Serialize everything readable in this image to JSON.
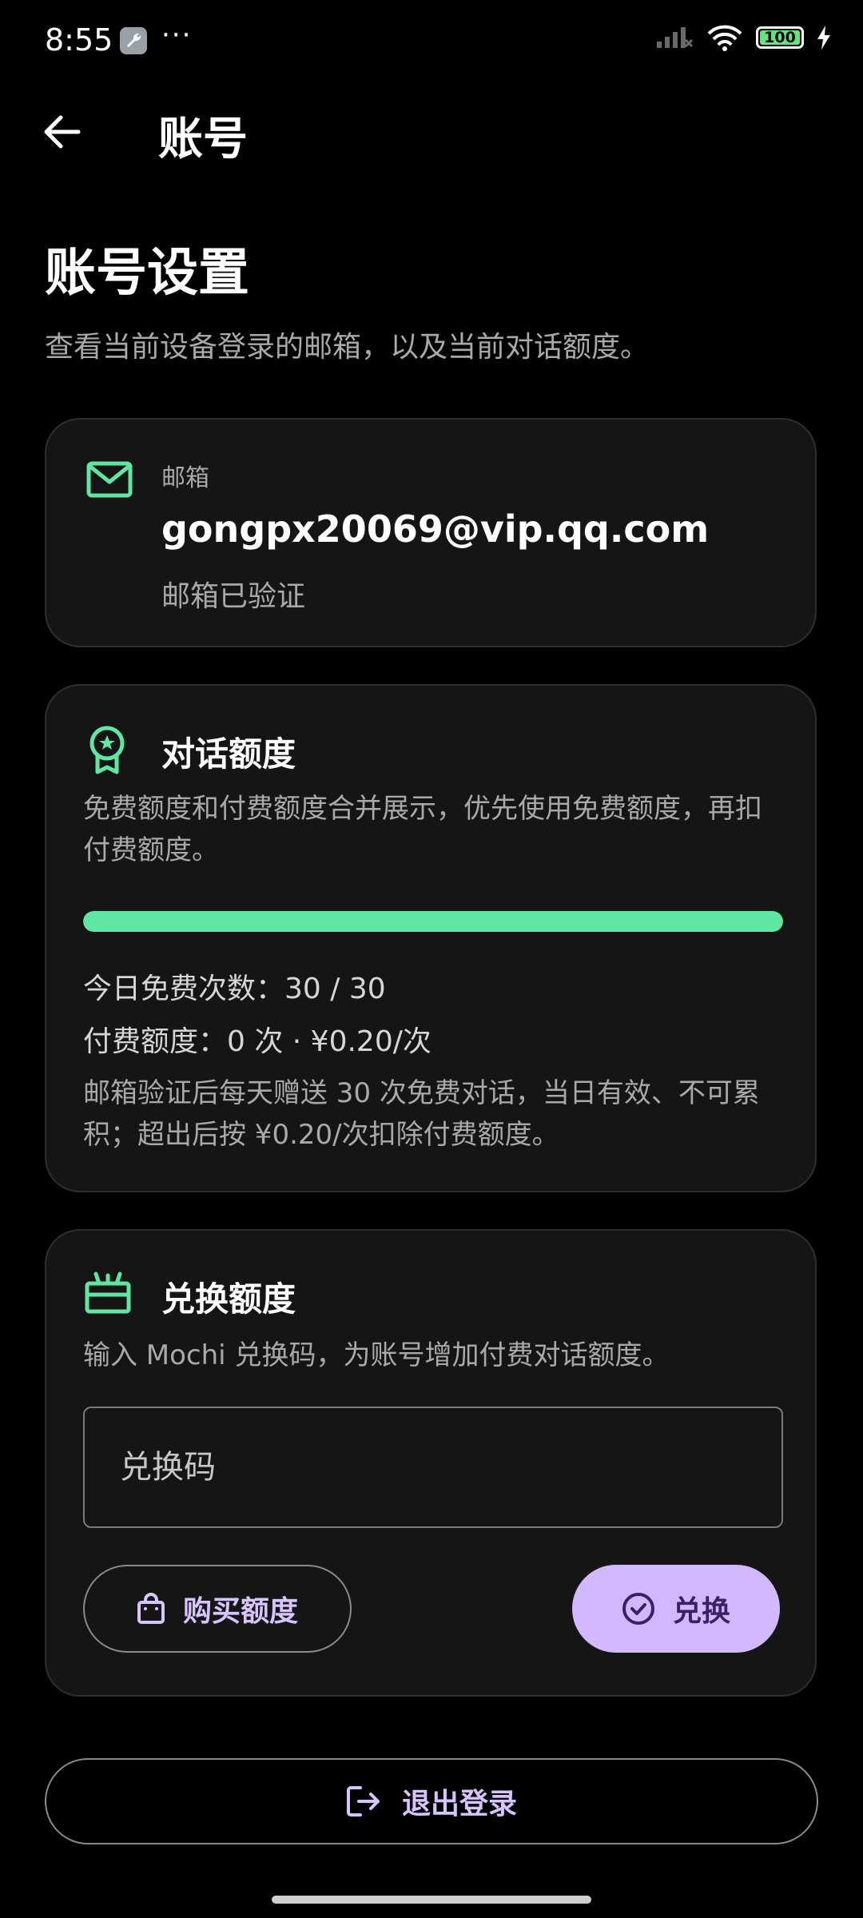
{
  "status_bar": {
    "time": "8:55",
    "dots": "···",
    "battery_level": 100,
    "battery_text": "100"
  },
  "app_bar": {
    "title": "账号"
  },
  "page": {
    "heading": "账号设置",
    "subtitle": "查看当前设备登录的邮箱，以及当前对话额度。"
  },
  "email_card": {
    "label": "邮箱",
    "email": "gongpx20069@vip.qq.com",
    "status": "邮箱已验证",
    "icon": "mail-icon"
  },
  "quota_card": {
    "title": "对话额度",
    "icon": "award-icon",
    "description": "免费额度和付费额度合并展示，优先使用免费额度，再扣付费额度。",
    "progress_fraction": 1.0,
    "free_line": "今日免费次数：30 / 30",
    "paid_line": "付费额度：0 次 · ¥0.20/次",
    "note": "邮箱验证后每天赠送 30 次免费对话，当日有效、不可累积；超出后按 ¥0.20/次扣除付费额度。",
    "accent_color": "#5ee6a3"
  },
  "redeem_card": {
    "title": "兑换额度",
    "icon": "gift-icon",
    "description": "输入 Mochi 兑换码，为账号增加付费对话额度。",
    "input_placeholder": "兑换码",
    "input_value": "",
    "buy_label": "购买额度",
    "redeem_label": "兑换",
    "button_color": "#d2b8ff"
  },
  "logout": {
    "label": "退出登录",
    "icon": "logout-icon"
  }
}
